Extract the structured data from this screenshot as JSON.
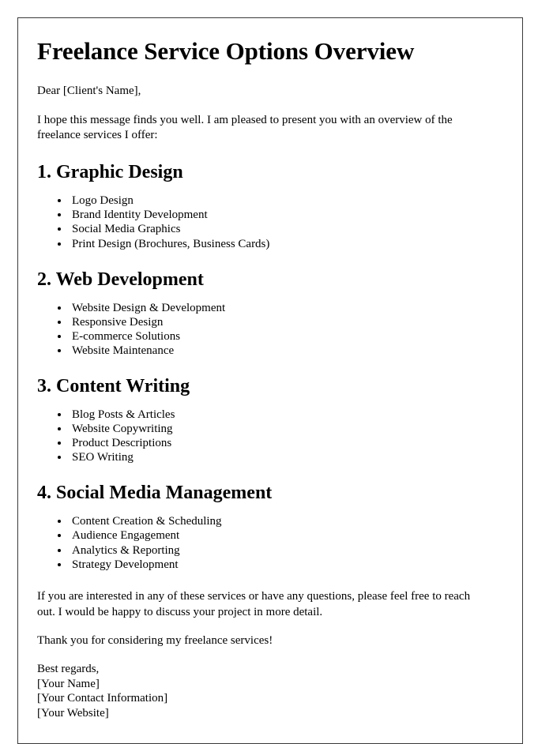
{
  "document": {
    "title": "Freelance Service Options Overview",
    "salutation": "Dear [Client's Name],",
    "intro": "I hope this message finds you well. I am pleased to present you with an overview of the freelance services I offer:",
    "sections": [
      {
        "heading": "1. Graphic Design",
        "items": [
          "Logo Design",
          "Brand Identity Development",
          "Social Media Graphics",
          "Print Design (Brochures, Business Cards)"
        ]
      },
      {
        "heading": "2. Web Development",
        "items": [
          "Website Design & Development",
          "Responsive Design",
          "E-commerce Solutions",
          "Website Maintenance"
        ]
      },
      {
        "heading": "3. Content Writing",
        "items": [
          "Blog Posts & Articles",
          "Website Copywriting",
          "Product Descriptions",
          "SEO Writing"
        ]
      },
      {
        "heading": "4. Social Media Management",
        "items": [
          "Content Creation & Scheduling",
          "Audience Engagement",
          "Analytics & Reporting",
          "Strategy Development"
        ]
      }
    ],
    "closing_paragraph": "If you are interested in any of these services or have any questions, please feel free to reach out. I would be happy to discuss your project in more detail.",
    "thanks_paragraph": "Thank you for considering my freelance services!",
    "signature": {
      "valediction": "Best regards,",
      "name": "[Your Name]",
      "contact": "[Your Contact Information]",
      "website": "[Your Website]"
    }
  },
  "colors": {
    "text": "#000000",
    "page_border": "#3a3a3a",
    "page_background": "#ffffff"
  }
}
